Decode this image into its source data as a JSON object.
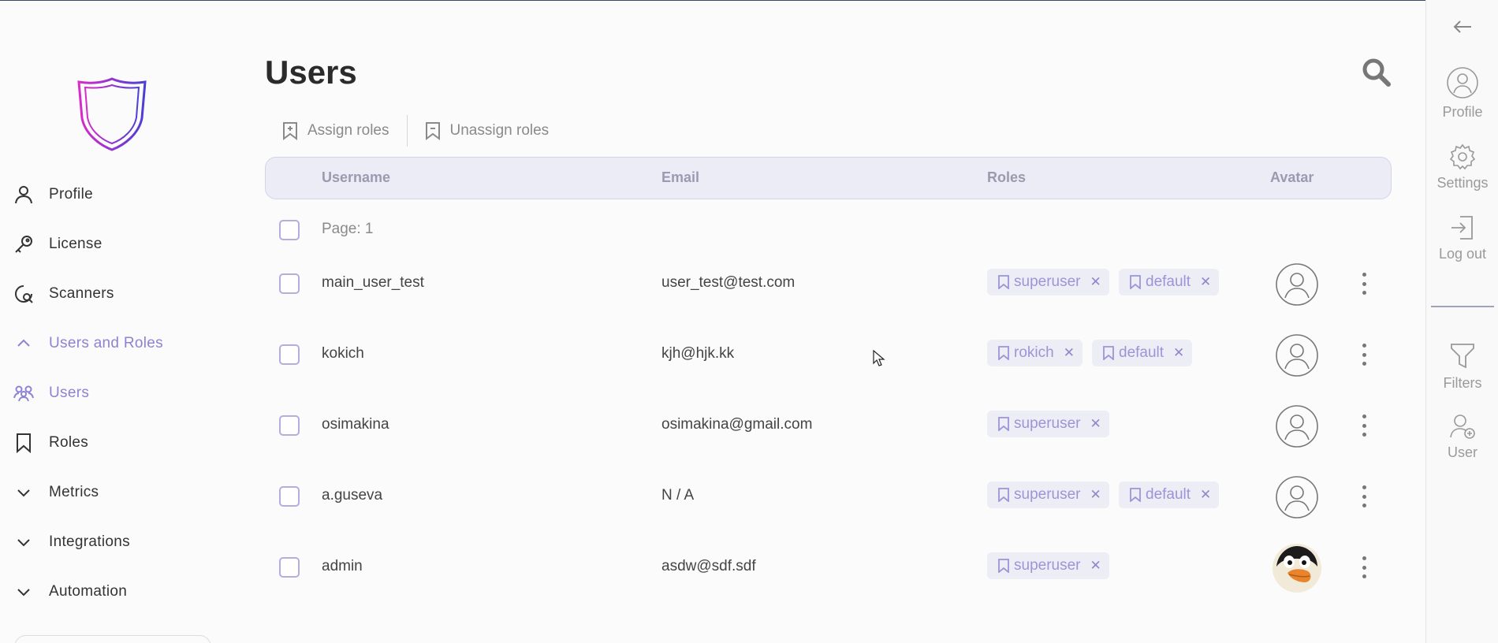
{
  "sidebar": {
    "items": [
      {
        "label": "Profile"
      },
      {
        "label": "License"
      },
      {
        "label": "Scanners"
      },
      {
        "label": "Users and Roles"
      },
      {
        "label": "Users"
      },
      {
        "label": "Roles"
      },
      {
        "label": "Metrics"
      },
      {
        "label": "Integrations"
      },
      {
        "label": "Automation"
      }
    ]
  },
  "main": {
    "title": "Users",
    "toolbar": {
      "assign_label": "Assign roles",
      "unassign_label": "Unassign roles"
    },
    "table": {
      "headers": {
        "username": "Username",
        "email": "Email",
        "roles": "Roles",
        "avatar": "Avatar"
      },
      "page_label": "Page: 1",
      "rows": [
        {
          "username": "main_user_test",
          "email": "user_test@test.com",
          "roles": [
            "superuser",
            "default"
          ]
        },
        {
          "username": "kokich",
          "email": "kjh@hjk.kk",
          "roles": [
            "rokich",
            "default"
          ]
        },
        {
          "username": "osimakina",
          "email": "osimakina@gmail.com",
          "roles": [
            "superuser"
          ]
        },
        {
          "username": "a.guseva",
          "email": "N / A",
          "roles": [
            "superuser",
            "default"
          ]
        },
        {
          "username": "admin",
          "email": "asdw@sdf.sdf",
          "roles": [
            "superuser"
          ]
        }
      ]
    }
  },
  "rail": {
    "profile_label": "Profile",
    "settings_label": "Settings",
    "logout_label": "Log out",
    "filters_label": "Filters",
    "user_label": "User"
  },
  "colors": {
    "accent": "#8d83d3",
    "tag_bg": "#ededf6",
    "header_bg": "#ececf6"
  }
}
